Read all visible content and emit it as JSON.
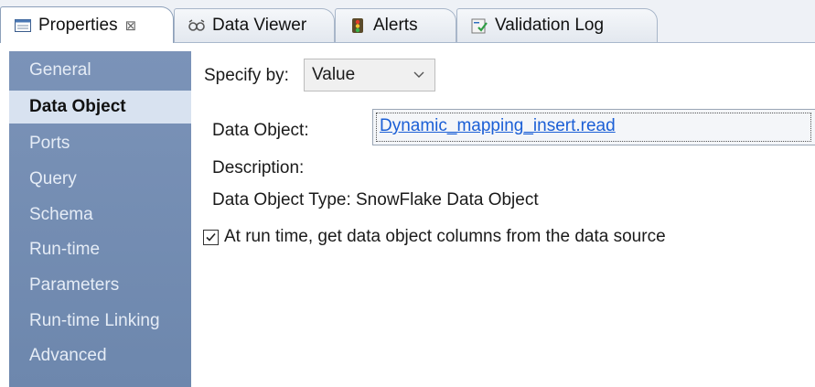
{
  "tabs": [
    {
      "label": "Properties",
      "close": "⊠",
      "icon": "properties-icon"
    },
    {
      "label": "Data Viewer",
      "icon": "data-viewer-icon"
    },
    {
      "label": "Alerts",
      "icon": "alerts-icon"
    },
    {
      "label": "Validation Log",
      "icon": "validation-log-icon"
    }
  ],
  "sidebar": {
    "items": [
      {
        "label": "General"
      },
      {
        "label": "Data Object"
      },
      {
        "label": "Ports"
      },
      {
        "label": "Query"
      },
      {
        "label": "Schema"
      },
      {
        "label": "Run-time"
      },
      {
        "label": "Parameters"
      },
      {
        "label": "Run-time Linking"
      },
      {
        "label": "Advanced"
      }
    ],
    "selected": "Data Object"
  },
  "main": {
    "specify_label": "Specify by:",
    "specify_value": "Value",
    "data_object_label": "Data Object:",
    "data_object_value": "Dynamic_mapping_insert.read",
    "description_label": "Description:",
    "type_text": "Data Object Type: SnowFlake Data Object",
    "checkbox_label": "At run time, get data object columns from the data source",
    "checkbox_checked": true
  },
  "colors": {
    "sidebar_bg": "#7b93b8",
    "sidebar_selected": "#d8e2f0",
    "link": "#1b5fd6"
  }
}
